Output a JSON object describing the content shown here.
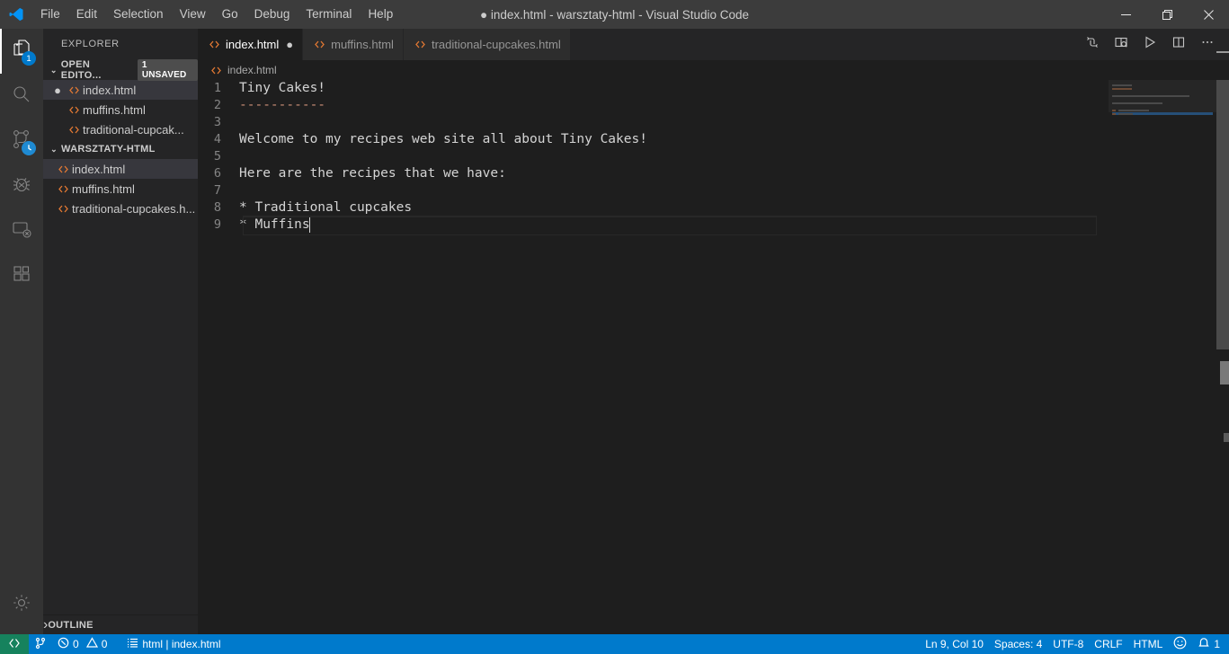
{
  "titlebar": {
    "logo_icon": "vscode-logo-icon",
    "menus": [
      "File",
      "Edit",
      "Selection",
      "View",
      "Go",
      "Debug",
      "Terminal",
      "Help"
    ],
    "window_title": "● index.html - warsztaty-html - Visual Studio Code",
    "controls": [
      {
        "name": "minimize-button",
        "icon": "minimize-icon"
      },
      {
        "name": "restore-button",
        "icon": "restore-icon"
      },
      {
        "name": "close-button",
        "icon": "close-icon"
      }
    ]
  },
  "activitybar": {
    "items": [
      {
        "name": "explorer",
        "icon": "files-icon",
        "active": true,
        "badge": "1"
      },
      {
        "name": "search",
        "icon": "search-icon",
        "active": false,
        "badge": ""
      },
      {
        "name": "source-control",
        "icon": "source-control-icon",
        "active": false,
        "badge": "clock"
      },
      {
        "name": "debug",
        "icon": "debug-icon",
        "active": false,
        "badge": ""
      },
      {
        "name": "remote-explorer",
        "icon": "remote-explorer-icon",
        "active": false,
        "badge": ""
      },
      {
        "name": "extensions",
        "icon": "extensions-icon",
        "active": false,
        "badge": ""
      }
    ],
    "bottom": [
      {
        "name": "manage-settings",
        "icon": "gear-icon"
      }
    ]
  },
  "sidebar": {
    "title": "EXPLORER",
    "open_editors": {
      "label": "OPEN EDITO...",
      "badge": "1 UNSAVED",
      "chevron": "⌄",
      "items": [
        {
          "label": "index.html",
          "dirty": "●",
          "selected": true
        },
        {
          "label": "muffins.html",
          "dirty": "",
          "selected": false
        },
        {
          "label": "traditional-cupcak...",
          "dirty": "",
          "selected": false
        }
      ]
    },
    "folder": {
      "label": "WARSZTATY-HTML",
      "chevron": "⌄",
      "items": [
        {
          "label": "index.html",
          "selected": true
        },
        {
          "label": "muffins.html",
          "selected": false
        },
        {
          "label": "traditional-cupcakes.h...",
          "selected": false
        }
      ]
    },
    "outline": {
      "label": "OUTLINE",
      "chevron": "›"
    }
  },
  "editor": {
    "tabs": [
      {
        "label": "index.html",
        "active": true,
        "dirty": "●"
      },
      {
        "label": "muffins.html",
        "active": false,
        "dirty": ""
      },
      {
        "label": "traditional-cupcakes.html",
        "active": false,
        "dirty": ""
      }
    ],
    "actions": [
      {
        "name": "open-changes-button",
        "icon": "compare-changes-icon"
      },
      {
        "name": "open-preview-button",
        "icon": "open-preview-icon"
      },
      {
        "name": "run-button",
        "icon": "play-icon"
      },
      {
        "name": "split-editor-button",
        "icon": "split-editor-icon"
      },
      {
        "name": "more-actions-button",
        "icon": "ellipsis-icon"
      }
    ],
    "breadcrumb": "index.html",
    "lines": [
      {
        "n": "1",
        "text": "Tiny Cakes!"
      },
      {
        "n": "2",
        "text": "-----------"
      },
      {
        "n": "3",
        "text": ""
      },
      {
        "n": "4",
        "text": "Welcome to my recipes web site all about Tiny Cakes!"
      },
      {
        "n": "5",
        "text": ""
      },
      {
        "n": "6",
        "text": "Here are the recipes that we have:"
      },
      {
        "n": "7",
        "text": ""
      },
      {
        "n": "8",
        "text": "* Traditional cupcakes"
      },
      {
        "n": "9",
        "text": "* Muffins"
      }
    ]
  },
  "statusbar": {
    "remote_icon": "remote-indicator-icon",
    "left": [
      {
        "name": "source-control-branch",
        "icon": "branch-icon",
        "text": ""
      },
      {
        "name": "problems",
        "icon": "error-warning-icon",
        "text": "0  0",
        "errors": "0",
        "warnings": "0"
      },
      {
        "name": "html-tag-info",
        "icon": "list-icon",
        "text": "html | index.html"
      }
    ],
    "right": [
      {
        "name": "editor-position",
        "text": "Ln 9, Col 10"
      },
      {
        "name": "editor-indentation",
        "text": "Spaces: 4"
      },
      {
        "name": "editor-encoding",
        "text": "UTF-8"
      },
      {
        "name": "editor-eol",
        "text": "CRLF"
      },
      {
        "name": "editor-language",
        "text": "HTML"
      },
      {
        "name": "feedback-smiley",
        "text": "☺"
      },
      {
        "name": "notifications",
        "text": "1"
      }
    ]
  },
  "colors": {
    "accent": "#007acc",
    "remote_green": "#16825d",
    "titlebar": "#3c3c3c",
    "activitybar": "#333333",
    "sidebar": "#252526",
    "editor": "#1e1e1e",
    "html_icon": "#e37933"
  }
}
